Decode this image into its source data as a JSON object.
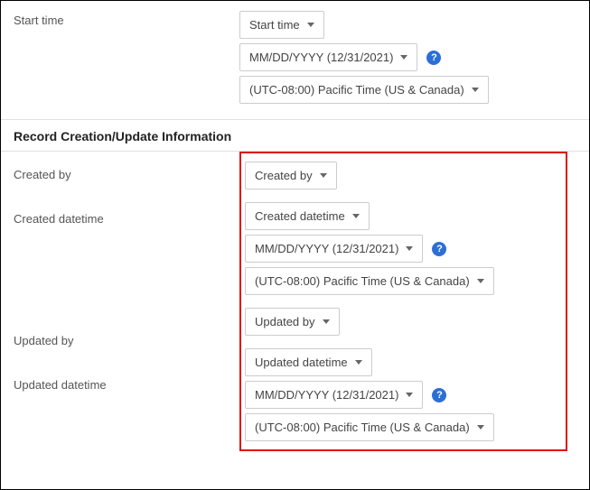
{
  "start_time": {
    "label": "Start time",
    "field_select": "Start time",
    "date_format": "MM/DD/YYYY (12/31/2021)",
    "timezone": "(UTC-08:00) Pacific Time (US & Canada)"
  },
  "section": {
    "title": "Record Creation/Update Information"
  },
  "created_by": {
    "label": "Created by",
    "field_select": "Created by"
  },
  "created_datetime": {
    "label": "Created datetime",
    "field_select": "Created datetime",
    "date_format": "MM/DD/YYYY (12/31/2021)",
    "timezone": "(UTC-08:00) Pacific Time (US & Canada)"
  },
  "updated_by": {
    "label": "Updated by",
    "field_select": "Updated by"
  },
  "updated_datetime": {
    "label": "Updated datetime",
    "field_select": "Updated datetime",
    "date_format": "MM/DD/YYYY (12/31/2021)",
    "timezone": "(UTC-08:00) Pacific Time (US & Canada)"
  },
  "help_glyph": "?"
}
